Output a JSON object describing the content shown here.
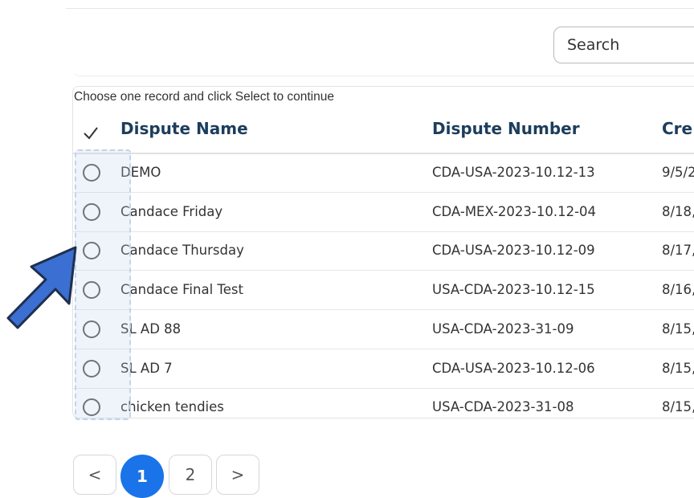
{
  "search": {
    "placeholder": "Search"
  },
  "table": {
    "instruction": "Choose one record and click Select to continue",
    "headers": {
      "name": "Dispute Name",
      "number": "Dispute Number",
      "created": "Cre"
    },
    "rows": [
      {
        "name": "DEMO",
        "number": "CDA-USA-2023-10.12-13",
        "created": "9/5/2"
      },
      {
        "name": "Candace Friday",
        "number": "CDA-MEX-2023-10.12-04",
        "created": "8/18,"
      },
      {
        "name": "Candace Thursday",
        "number": "CDA-USA-2023-10.12-09",
        "created": "8/17,"
      },
      {
        "name": "Candace Final Test",
        "number": "USA-CDA-2023-10.12-15",
        "created": "8/16,"
      },
      {
        "name": "SL AD 88",
        "number": "USA-CDA-2023-31-09",
        "created": "8/15,"
      },
      {
        "name": "SL AD 7",
        "number": "CDA-USA-2023-10.12-06",
        "created": "8/15,"
      },
      {
        "name": "chicken tendies",
        "number": "USA-CDA-2023-31-08",
        "created": "8/15,"
      }
    ]
  },
  "pagination": {
    "prev": "<",
    "page1": "1",
    "page2": "2",
    "next": ">"
  },
  "colors": {
    "accent": "#1a73e8",
    "header_text": "#1d3d5c",
    "arrow": "#3b6fd1"
  },
  "icons": {
    "select_all": "check-icon",
    "pointer": "arrow-pointer-icon"
  }
}
